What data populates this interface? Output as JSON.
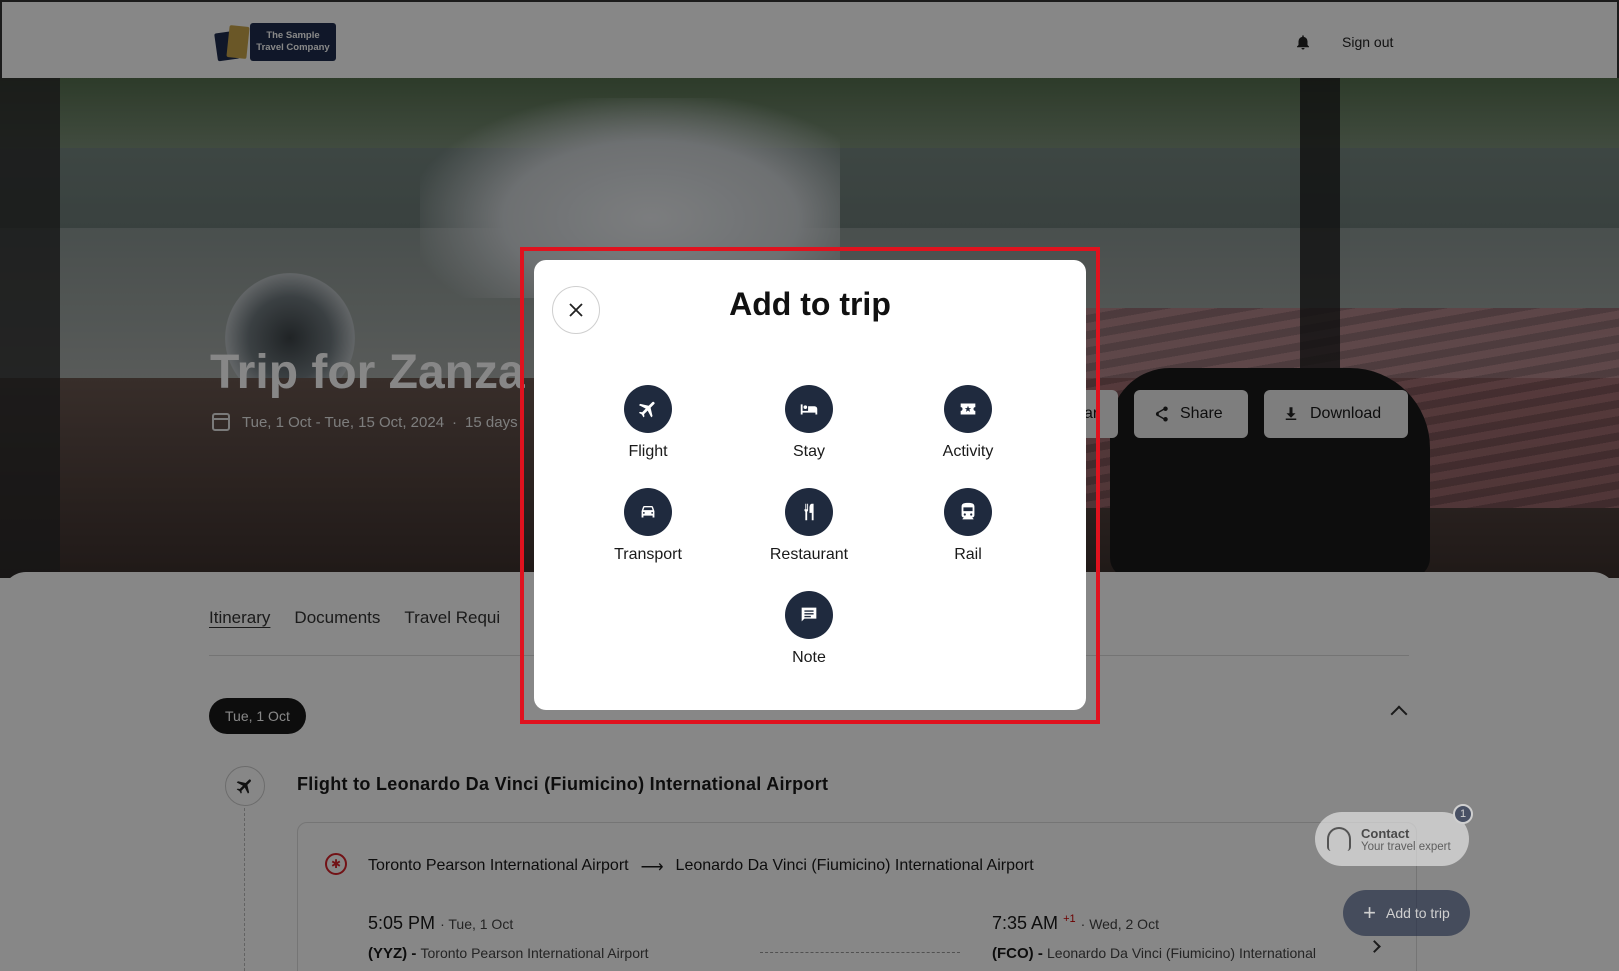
{
  "header": {
    "logo_line1": "The Sample",
    "logo_line2": "Travel Company",
    "sign_out": "Sign out"
  },
  "hero": {
    "title": "Trip for Zanza",
    "dates": "Tue, 1 Oct - Tue, 15 Oct, 2024",
    "duration": "15 days",
    "buttons": {
      "partial": "ar",
      "share": "Share",
      "download": "Download"
    }
  },
  "tabs": [
    {
      "label": "Itinerary",
      "active": true
    },
    {
      "label": "Documents"
    },
    {
      "label": "Travel Requi"
    }
  ],
  "itinerary": {
    "date_chip": "Tue, 1 Oct",
    "flight_heading": "Flight to Leonardo Da Vinci (Fiumicino) International Airport",
    "from_airport": "Toronto Pearson International Airport",
    "to_airport": "Leonardo Da Vinci (Fiumicino) International Airport",
    "dep_time": "5:05 PM",
    "dep_date": "Tue, 1 Oct",
    "dep_code": "(YYZ) -",
    "dep_name": "Toronto Pearson International Airport",
    "arr_time": "7:35 AM",
    "arr_plus": "+1",
    "arr_date": "Wed, 2 Oct",
    "arr_code": "(FCO) -",
    "arr_name": "Leonardo Da Vinci (Fiumicino) International"
  },
  "contact": {
    "title": "Contact",
    "subtitle": "Your travel expert",
    "badge": "1"
  },
  "fab": {
    "label": "Add to trip"
  },
  "modal": {
    "title": "Add to trip",
    "options": [
      {
        "label": "Flight",
        "icon": "plane-icon"
      },
      {
        "label": "Stay",
        "icon": "bed-icon"
      },
      {
        "label": "Activity",
        "icon": "ticket-icon"
      },
      {
        "label": "Transport",
        "icon": "car-icon"
      },
      {
        "label": "Restaurant",
        "icon": "utensils-icon"
      },
      {
        "label": "Rail",
        "icon": "train-icon"
      },
      {
        "label": "Note",
        "icon": "note-icon"
      }
    ]
  },
  "colors": {
    "highlight": "#e0121e",
    "icon_circle": "#1f2a3e",
    "fab": "#1a2540"
  }
}
